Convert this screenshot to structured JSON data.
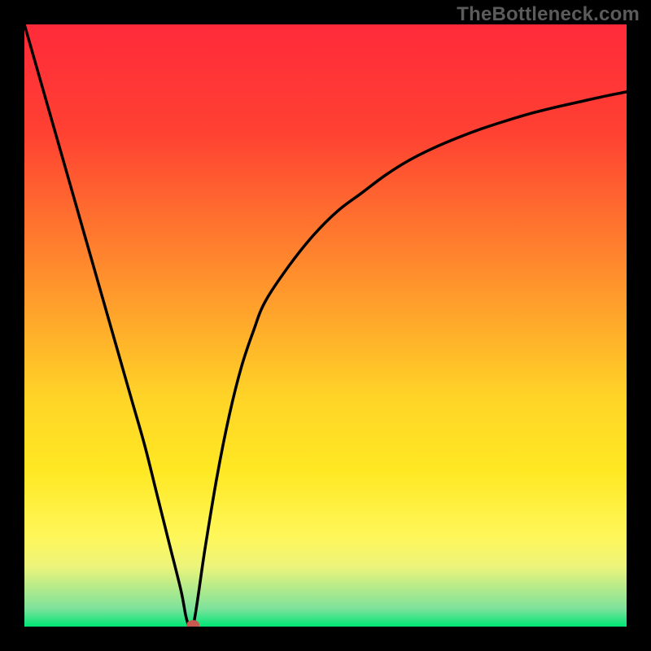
{
  "watermark": "TheBottleneck.com",
  "colors": {
    "background": "#000000",
    "watermark": "#5b5b5b",
    "curve": "#000000",
    "gradient_stops": [
      {
        "offset": 0,
        "color": "#ff2a3a"
      },
      {
        "offset": 18,
        "color": "#ff4132"
      },
      {
        "offset": 45,
        "color": "#ff9a2c"
      },
      {
        "offset": 62,
        "color": "#ffd427"
      },
      {
        "offset": 74,
        "color": "#ffe823"
      },
      {
        "offset": 85,
        "color": "#fff75a"
      },
      {
        "offset": 90,
        "color": "#ecf47a"
      },
      {
        "offset": 97,
        "color": "#7ee29b"
      },
      {
        "offset": 100,
        "color": "#00e676"
      }
    ],
    "marker": "#c85a52"
  },
  "chart_data": {
    "type": "line",
    "title": "",
    "xlabel": "",
    "ylabel": "",
    "xlim": [
      0,
      100
    ],
    "ylim": [
      0,
      100
    ],
    "x": [
      0,
      2,
      4,
      6,
      8,
      10,
      12,
      14,
      16,
      18,
      20,
      22,
      24,
      26,
      27,
      28,
      30,
      32,
      34,
      36,
      38,
      40,
      44,
      48,
      52,
      56,
      60,
      64,
      68,
      72,
      76,
      80,
      84,
      88,
      92,
      96,
      100
    ],
    "values": [
      100,
      93,
      86,
      79,
      72,
      65,
      58,
      51,
      44,
      37,
      30,
      22,
      14,
      6,
      1,
      0,
      13,
      25,
      35,
      43,
      49,
      54,
      60,
      65,
      69,
      72,
      75,
      77.5,
      79.5,
      81.2,
      82.7,
      84,
      85.2,
      86.2,
      87.1,
      88,
      88.8
    ],
    "marker": {
      "x": 28,
      "y": 0
    },
    "grid": false,
    "legend": false
  }
}
